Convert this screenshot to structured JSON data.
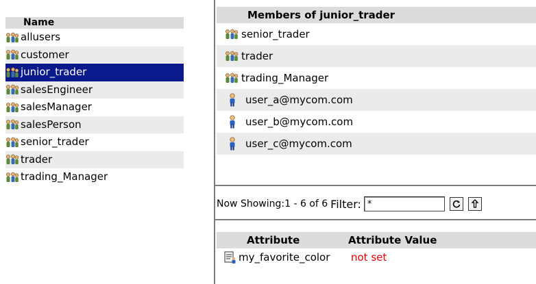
{
  "groups": {
    "header": "Name",
    "items": [
      {
        "label": "allusers",
        "selected": false
      },
      {
        "label": "customer",
        "selected": false
      },
      {
        "label": "junior_trader",
        "selected": true
      },
      {
        "label": "salesEngineer",
        "selected": false
      },
      {
        "label": "salesManager",
        "selected": false
      },
      {
        "label": "salesPerson",
        "selected": false
      },
      {
        "label": "senior_trader",
        "selected": false
      },
      {
        "label": "trader",
        "selected": false
      },
      {
        "label": "trading_Manager",
        "selected": false
      }
    ]
  },
  "members": {
    "header": "Members of junior_trader",
    "items": [
      {
        "label": "senior_trader",
        "icon": "group-icon"
      },
      {
        "label": "trader",
        "icon": "group-icon"
      },
      {
        "label": "trading_Manager",
        "icon": "group-icon"
      },
      {
        "label": "user_a@mycom.com",
        "icon": "user-icon"
      },
      {
        "label": "user_b@mycom.com",
        "icon": "user-icon"
      },
      {
        "label": "user_c@mycom.com",
        "icon": "user-icon"
      }
    ]
  },
  "status": {
    "showing": "Now Showing:1 - 6 of 6",
    "filter_label": "Filter:",
    "filter_value": "*"
  },
  "attributes": {
    "col_attribute": "Attribute",
    "col_value": "Attribute Value",
    "rows": [
      {
        "name": "my_favorite_color",
        "value": "not set"
      }
    ]
  },
  "colors": {
    "selection": "#0a1a8c",
    "header_bg": "#dcdcdc",
    "not_set": "#e00000"
  }
}
